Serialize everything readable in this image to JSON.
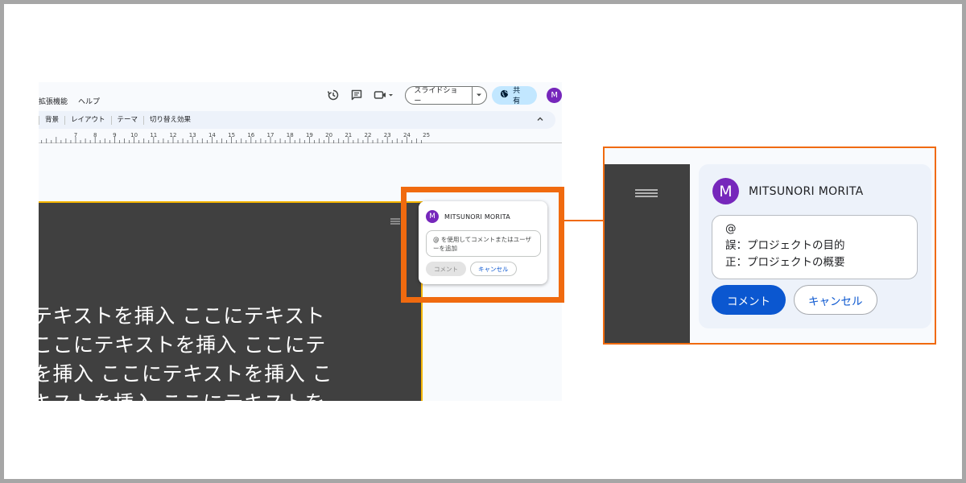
{
  "menu": {
    "items": [
      "拡張機能",
      "ヘルプ"
    ]
  },
  "header": {
    "slideshow_label": "スライドショー",
    "share_label": "共有",
    "avatar_letter": "M"
  },
  "toolbar": {
    "items": [
      "背景",
      "レイアウト",
      "テーマ",
      "切り替え効果"
    ]
  },
  "ruler": {
    "labels": [
      "7",
      "8",
      "9",
      "10",
      "11",
      "12",
      "13",
      "14",
      "15",
      "16",
      "17",
      "18",
      "19",
      "20",
      "21",
      "22",
      "23",
      "24",
      "25"
    ]
  },
  "slide": {
    "lines": [
      "テキストを挿入 ここにテキスト",
      "ここにテキストを挿入 ここにテ",
      "を挿入 ここにテキストを挿入 こ",
      "キストを挿入 ここにテキストを"
    ]
  },
  "mini_comment": {
    "avatar_letter": "M",
    "user_name": "MITSUNORI MORITA",
    "placeholder": "@ を使用してコメントまたはユーザーを追加",
    "comment_label": "コメント",
    "cancel_label": "キャンセル"
  },
  "zoom_comment": {
    "avatar_letter": "M",
    "user_name": "MITSUNORI MORITA",
    "lines": [
      "@",
      "誤：プロジェクトの目的",
      "正：プロジェクトの概要"
    ],
    "comment_label": "コメント",
    "cancel_label": "キャンセル"
  },
  "colors": {
    "highlight": "#f06a0f",
    "avatar": "#7627bb",
    "primary": "#0b57d0",
    "share_bg": "#c2e7ff",
    "slide_bg": "#404040"
  },
  "icons": [
    "history-icon",
    "comment-icon",
    "video-icon",
    "globe-icon",
    "chevron-down-icon",
    "chevron-up-icon",
    "drag-handle-icon"
  ]
}
